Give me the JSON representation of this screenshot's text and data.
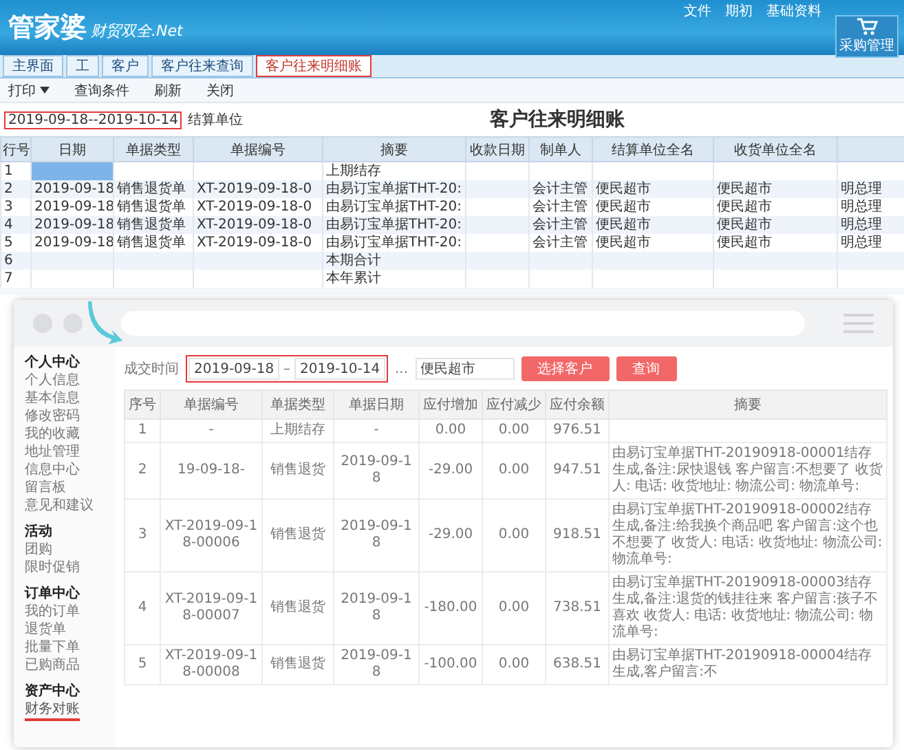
{
  "app": {
    "logo": "管家婆",
    "logo_sub": "财贸双全.Net",
    "top_menu": [
      "文件",
      "期初",
      "基础资料"
    ],
    "shortcut": "采购管理",
    "tabs": [
      {
        "label": "主界面",
        "selected": false
      },
      {
        "label": "工",
        "selected": false
      },
      {
        "label": "客户",
        "selected": false
      },
      {
        "label": "客户往来查询",
        "selected": false
      },
      {
        "label": "客户往来明细账",
        "selected": true
      }
    ],
    "toolbar": [
      {
        "label": "打印",
        "dropdown": true
      },
      {
        "label": "查询条件",
        "dropdown": false
      },
      {
        "label": "刷新",
        "dropdown": false
      },
      {
        "label": "关闭",
        "dropdown": false
      }
    ],
    "report_title": "客户往来明细账",
    "date_range": {
      "value": "2019-09-18--2019-10-14",
      "highlighted": true
    },
    "settle_label": "结算单位",
    "table": {
      "columns": [
        "行号",
        "日期",
        "单据类型",
        "单据编号",
        "摘要",
        "收款日期",
        "制单人",
        "结算单位全名",
        "收货单位全名"
      ],
      "rows": [
        {
          "row_no": "1",
          "summary": "上期结存",
          "selected": true
        },
        {
          "row_no": "2",
          "date": "2019-09-18",
          "doc_type": "销售退货单",
          "doc_no": "XT-2019-09-18-0",
          "summary": "由易订宝单据THT-20:",
          "handler": "会计主管",
          "settle_unit": "便民超市",
          "receive_unit": "便民超市",
          "column_10": "明总理",
          "selected": false
        },
        {
          "row_no": "3",
          "date": "2019-09-18",
          "doc_type": "销售退货单",
          "doc_no": "XT-2019-09-18-0",
          "summary": "由易订宝单据THT-20:",
          "handler": "会计主管",
          "settle_unit": "便民超市",
          "receive_unit": "便民超市",
          "column_10": "明总理",
          "selected": false
        },
        {
          "row_no": "4",
          "date": "2019-09-18",
          "doc_type": "销售退货单",
          "doc_no": "XT-2019-09-18-0",
          "summary": "由易订宝单据THT-20:",
          "handler": "会计主管",
          "settle_unit": "便民超市",
          "receive_unit": "便民超市",
          "column_10": "明总理",
          "selected": false
        },
        {
          "row_no": "5",
          "date": "2019-09-18",
          "doc_type": "销售退货单",
          "doc_no": "XT-2019-09-18-0",
          "summary": "由易订宝单据THT-20:",
          "handler": "会计主管",
          "settle_unit": "便民超市",
          "receive_unit": "便民超市",
          "column_10": "明总理",
          "selected": false
        },
        {
          "row_no": "6",
          "summary": "本期合计",
          "selected": false
        },
        {
          "row_no": "7",
          "summary": "本年累计",
          "selected": false
        }
      ]
    }
  },
  "web": {
    "sidebar": [
      {
        "title": "个人中心",
        "items": [
          {
            "label": "个人信息",
            "selected": false
          },
          {
            "label": "基本信息",
            "selected": false
          },
          {
            "label": "修改密码",
            "selected": false
          },
          {
            "label": "我的收藏",
            "selected": false
          },
          {
            "label": "地址管理",
            "selected": false
          },
          {
            "label": "信息中心",
            "selected": false
          },
          {
            "label": "留言板",
            "selected": false
          },
          {
            "label": "意见和建议",
            "selected": false
          }
        ]
      },
      {
        "title": "活动",
        "items": [
          {
            "label": "团购",
            "selected": false
          },
          {
            "label": "限时促销",
            "selected": false
          }
        ]
      },
      {
        "title": "订单中心",
        "items": [
          {
            "label": "我的订单",
            "selected": false
          },
          {
            "label": "退货单",
            "selected": false
          },
          {
            "label": "批量下单",
            "selected": false
          },
          {
            "label": "已购商品",
            "selected": false
          }
        ]
      },
      {
        "title": "资产中心",
        "items": [
          {
            "label": "财务对账",
            "selected": true
          }
        ]
      }
    ],
    "filter": {
      "label": "成交时间",
      "start": "2019-09-18",
      "separator": "–",
      "end": "2019-10-14",
      "more": "...",
      "highlighted": true,
      "customer": "便民超市",
      "buttons": [
        "选择客户",
        "查询"
      ]
    },
    "table": {
      "columns": [
        "序号",
        "单据编号",
        "单据类型",
        "单据日期",
        "应付增加",
        "应付减少",
        "应付余额",
        "摘要"
      ],
      "rows": [
        [
          "1",
          "-",
          "上期结存",
          "-",
          "0.00",
          "0.00",
          "976.51"
        ],
        [
          "2",
          "19-09-18-",
          "销售退货",
          "2019-09-18",
          "-29.00",
          "0.00",
          "947.51",
          "由易订宝单据THT-20190918-00001结存生成,备注:尿快退钱 客户留言:不想要了 收货人: 电话: 收货地址: 物流公司: 物流单号:"
        ],
        [
          "3",
          "XT-2019-09-18-00006",
          "销售退货",
          "2019-09-18",
          "-29.00",
          "0.00",
          "918.51",
          "由易订宝单据THT-20190918-00002结存生成,备注:给我换个商品吧 客户留言:这个也不想要了 收货人: 电话: 收货地址: 物流公司: 物流单号:"
        ],
        [
          "4",
          "XT-2019-09-18-00007",
          "销售退货",
          "2019-09-18",
          "-180.00",
          "0.00",
          "738.51",
          "由易订宝单据THT-20190918-00003结存生成,备注:退货的钱挂往来 客户留言:孩子不喜欢 收货人: 电话: 收货地址: 物流公司: 物流单号:"
        ],
        [
          "5",
          "XT-2019-09-18-00008",
          "销售退货",
          "2019-09-18",
          "-100.00",
          "0.00",
          "638.51",
          "由易订宝单据THT-20190918-00004结存生成,客户留言:不"
        ]
      ]
    }
  }
}
